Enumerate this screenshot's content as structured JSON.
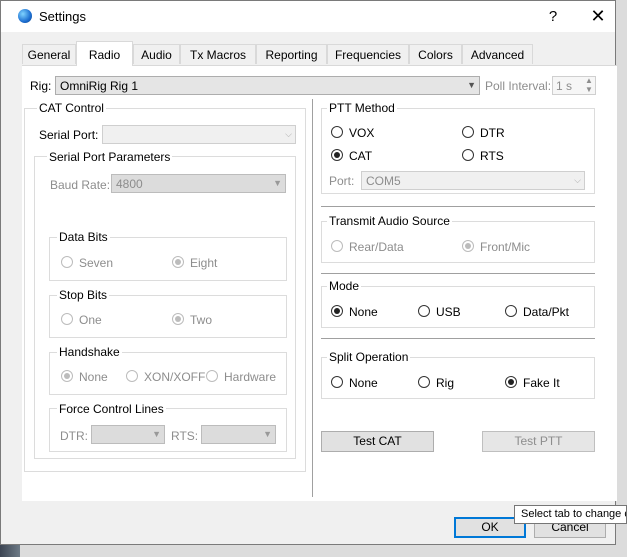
{
  "window": {
    "title": "Settings",
    "help": "?",
    "close": "✕"
  },
  "tabs": [
    {
      "label": "General",
      "active": false
    },
    {
      "label": "Radio",
      "active": true
    },
    {
      "label": "Audio",
      "active": false
    },
    {
      "label": "Tx Macros",
      "active": false
    },
    {
      "label": "Reporting",
      "active": false
    },
    {
      "label": "Frequencies",
      "active": false
    },
    {
      "label": "Colors",
      "active": false
    },
    {
      "label": "Advanced",
      "active": false
    }
  ],
  "rig": {
    "label": "Rig:",
    "value": "OmniRig Rig 1",
    "poll_label": "Poll Interval:",
    "poll_value": "1 s"
  },
  "cat": {
    "title": "CAT Control",
    "serial_port_label": "Serial Port:",
    "serial_port_value": "",
    "params_title": "Serial Port Parameters",
    "baud_label": "Baud Rate:",
    "baud_value": "4800",
    "data_bits": {
      "title": "Data Bits",
      "options": [
        "Seven",
        "Eight"
      ],
      "selected": "Eight"
    },
    "stop_bits": {
      "title": "Stop Bits",
      "options": [
        "One",
        "Two"
      ],
      "selected": "Two"
    },
    "handshake": {
      "title": "Handshake",
      "options": [
        "None",
        "XON/XOFF",
        "Hardware"
      ],
      "selected": "None"
    },
    "force": {
      "title": "Force Control Lines",
      "dtr_label": "DTR:",
      "rts_label": "RTS:"
    }
  },
  "ptt": {
    "title": "PTT Method",
    "options": [
      "VOX",
      "DTR",
      "CAT",
      "RTS"
    ],
    "selected": "CAT",
    "port_label": "Port:",
    "port_value": "COM5"
  },
  "audio_source": {
    "title": "Transmit Audio Source",
    "options": [
      "Rear/Data",
      "Front/Mic"
    ],
    "selected": "Front/Mic"
  },
  "mode": {
    "title": "Mode",
    "options": [
      "None",
      "USB",
      "Data/Pkt"
    ],
    "selected": "None"
  },
  "split": {
    "title": "Split Operation",
    "options": [
      "None",
      "Rig",
      "Fake It"
    ],
    "selected": "Fake It"
  },
  "buttons": {
    "test_cat": "Test CAT",
    "test_ptt": "Test PTT",
    "ok": "OK",
    "cancel": "Cancel"
  },
  "tooltip": "Select tab to change c"
}
